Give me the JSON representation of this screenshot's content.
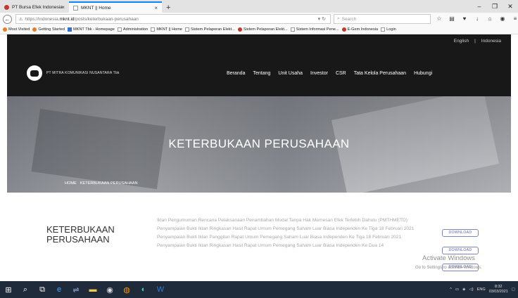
{
  "browser": {
    "tabs": [
      {
        "label": "PT Bursa Efek Indonesia"
      },
      {
        "label": "MKNT || Home"
      }
    ],
    "url_prefix": "https://indonesia.",
    "url_domain": "mknt.id",
    "url_path": "/posts/keterbukaan-perusahaan",
    "search_placeholder": "Search",
    "bookmarks": [
      {
        "label": "Most Visited",
        "icon": "orange"
      },
      {
        "label": "Getting Started",
        "icon": "orange"
      },
      {
        "label": "MKNT Tbk - Homepage",
        "icon": "blue"
      },
      {
        "label": "Administration",
        "icon": "page"
      },
      {
        "label": "MKNT || Home",
        "icon": "page"
      },
      {
        "label": "Sistem Pelaporan Elekt...",
        "icon": "page"
      },
      {
        "label": "Sistem Pelaporan Elekt...",
        "icon": "red"
      },
      {
        "label": "Sistem Informasi Pene...",
        "icon": "page"
      },
      {
        "label": "E-Gem Indonesia",
        "icon": "red"
      },
      {
        "label": "Login",
        "icon": "page"
      }
    ]
  },
  "site": {
    "lang": {
      "english": "English",
      "indonesia": "Indonesia"
    },
    "company": "PT MITRA KOMUNIKASI NUSANTARA Tbk",
    "menu": [
      "Beranda",
      "Tentang",
      "Unit Usaha",
      "Investor",
      "CSR",
      "Tata Kelola Perusahaan",
      "Hubungi"
    ],
    "hero_title": "KETERBUKAAN PERUSAHAAN",
    "breadcrumb": {
      "home": "HOME",
      "current": "KETERBUKAAN PERUSAHAAN"
    },
    "section_title": "KETERBUKAAN PERUSAHAAN",
    "documents": [
      "Iklan Pengumuman Rencana Pelaksanaan Penambahan Modal Tanpa Hak Memesan Efek Terlebih Dahulu (PMTHMETD)",
      "Penyampaian Bukti Iklan Ringkasan Hasil Rapat Umum Pemegang Saham Luar Biasa Independen Ke Tiga 18 Februari 2021",
      "Penyampaian Bukti Iklan Panggilan Rapat Umum Pemegang Saham Luar Biasa Independen Ke Tiga 18 Februari 2021",
      "Penyampaian Bukti Iklan Ringkasan Hasil Rapat Umum Pemegang Saham Luar Biasa Independen Ke Dua 14"
    ],
    "download_label": "DOWNLOAD",
    "watermark_title": "Activate Windows",
    "watermark_sub": "Go to Settings to activate Windows."
  },
  "taskbar": {
    "lang": "ENG",
    "time": "8:32",
    "date": "03/03/2021"
  }
}
